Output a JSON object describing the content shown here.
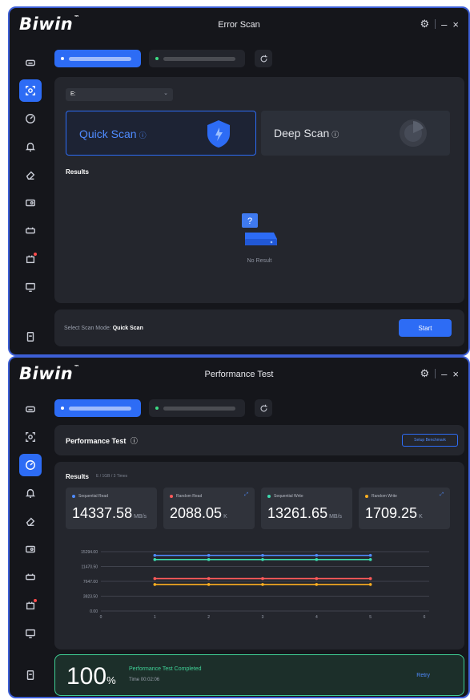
{
  "scan_window": {
    "logo": "Biwin",
    "title": "Error Scan",
    "drive": "E:",
    "quick_scan": "Quick Scan",
    "deep_scan": "Deep Scan",
    "results_label": "Results",
    "no_result": "No Result",
    "mode_prefix": "Select Scan Mode:",
    "mode_value": "Quick Scan",
    "start": "Start"
  },
  "perf_window": {
    "logo": "Biwin",
    "title": "Performance Test",
    "section_label": "Performance Test",
    "setup_button": "Setup Benchmark",
    "results_label": "Results",
    "results_sub": "E / 1GB / 3 Times",
    "metrics": [
      {
        "label": "Sequential Read",
        "value": "14337.58",
        "unit": "MB/s",
        "color": "#4f8bff"
      },
      {
        "label": "Random Read",
        "value": "2088.05",
        "unit": "K",
        "color": "#ff5a5a"
      },
      {
        "label": "Sequential Write",
        "value": "13261.65",
        "unit": "MB/s",
        "color": "#3ddcb0"
      },
      {
        "label": "Random Write",
        "value": "1709.25",
        "unit": "K",
        "color": "#ffb020"
      }
    ],
    "progress_text": "100",
    "progress_percent": 100,
    "percent_sign": "%",
    "completed": "Performance Test Completed",
    "elapsed": "Time 00:02:06",
    "retry": "Retry"
  },
  "window_controls": {
    "settings": "⚙",
    "minimize": "–",
    "close": "×"
  },
  "colors": {
    "accent": "#2d6cf5",
    "success": "#3fd196",
    "panel": "#24262d",
    "background": "#15161b"
  },
  "chart_data": {
    "type": "line",
    "x": [
      1,
      2,
      3,
      4,
      5
    ],
    "x_ticks": [
      "0",
      "1",
      "2",
      "3",
      "4",
      "5",
      "6"
    ],
    "xlim": [
      0,
      6
    ],
    "y_ticks": [
      "15294.00",
      "11470.50",
      "7647.00",
      "3823.50",
      "0.00"
    ],
    "ylim": [
      0,
      15294
    ],
    "grid": true,
    "series": [
      {
        "values": [
          14337.58,
          14337.58,
          14337.58,
          14337.58,
          14337.58
        ],
        "color": "#4f8bff"
      },
      {
        "values": [
          13261.65,
          13261.65,
          13261.65,
          13261.65,
          13261.65
        ],
        "color": "#3ddcb0"
      },
      {
        "values": [
          8352.2,
          8352.2,
          8352.2,
          8352.2,
          8352.2
        ],
        "color": "#ff5a5a"
      },
      {
        "values": [
          6837.0,
          6837.0,
          6837.0,
          6837.0,
          6837.0
        ],
        "color": "#ffb020"
      }
    ]
  }
}
